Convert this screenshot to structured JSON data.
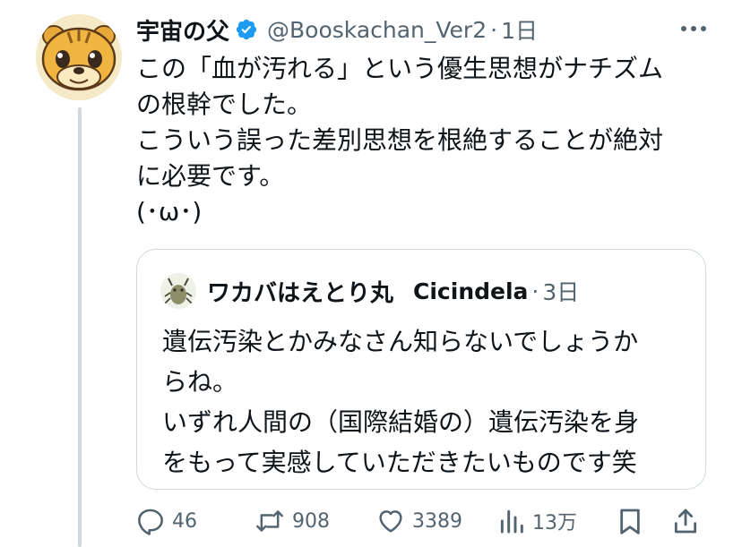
{
  "tweet": {
    "author_name": "宇宙の父",
    "handle": "@Booskachan_Ver2",
    "separator": "·",
    "time": "1日",
    "lines": [
      "この「血が汚れる」という優生思想がナチズム",
      "の根幹でした。",
      "こういう誤った差別思想を根絶することが絶対",
      "に必要です。",
      "(･ω･)"
    ]
  },
  "quote": {
    "author_name": "ワカバはえとり丸",
    "handle": "Cicindela",
    "separator": "·",
    "time": "3日",
    "lines": [
      "遺伝汚染とかみなさん知らないでしょうか",
      "らね。",
      "いずれ人間の（国際結婚の）遺伝汚染を身",
      "をもって実感していただきたいものです笑"
    ]
  },
  "actions": {
    "reply_count": "46",
    "retweet_count": "908",
    "like_count": "3389",
    "views_count": "13万"
  },
  "colors": {
    "text": "#0f1419",
    "secondary": "#536471",
    "verified": "#1d9bf0",
    "border": "#cfd9de"
  },
  "icons": {
    "verified": "verified-badge-icon",
    "more": "more-dots-icon",
    "reply": "reply-icon",
    "retweet": "retweet-icon",
    "like": "heart-icon",
    "views": "views-chart-icon",
    "bookmark": "bookmark-icon",
    "share": "share-icon"
  }
}
